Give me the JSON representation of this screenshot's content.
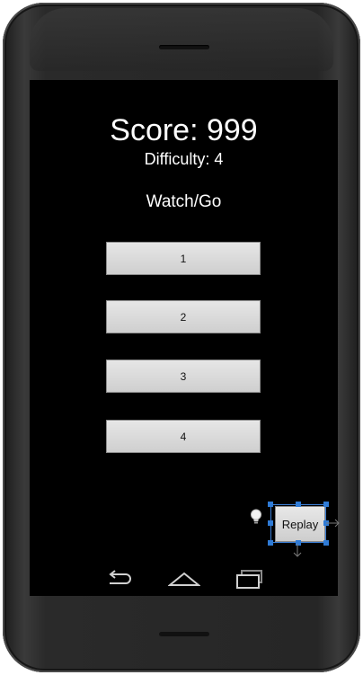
{
  "game": {
    "score_text": "Score: 999",
    "difficulty_text": "Difficulty: 4",
    "status_text": "Watch/Go"
  },
  "buttons": [
    {
      "label": "1"
    },
    {
      "label": "2"
    },
    {
      "label": "3"
    },
    {
      "label": "4"
    }
  ],
  "replay": {
    "label": "Replay",
    "hint_icon": "lightbulb-icon"
  },
  "navbar": {
    "back_icon": "back-icon",
    "home_icon": "home-icon",
    "recents_icon": "recents-icon"
  },
  "colors": {
    "screen_background": "#000000",
    "text": "#ffffff",
    "button_face": "#d9d9d9",
    "selection_accent": "#2f7bd6"
  }
}
